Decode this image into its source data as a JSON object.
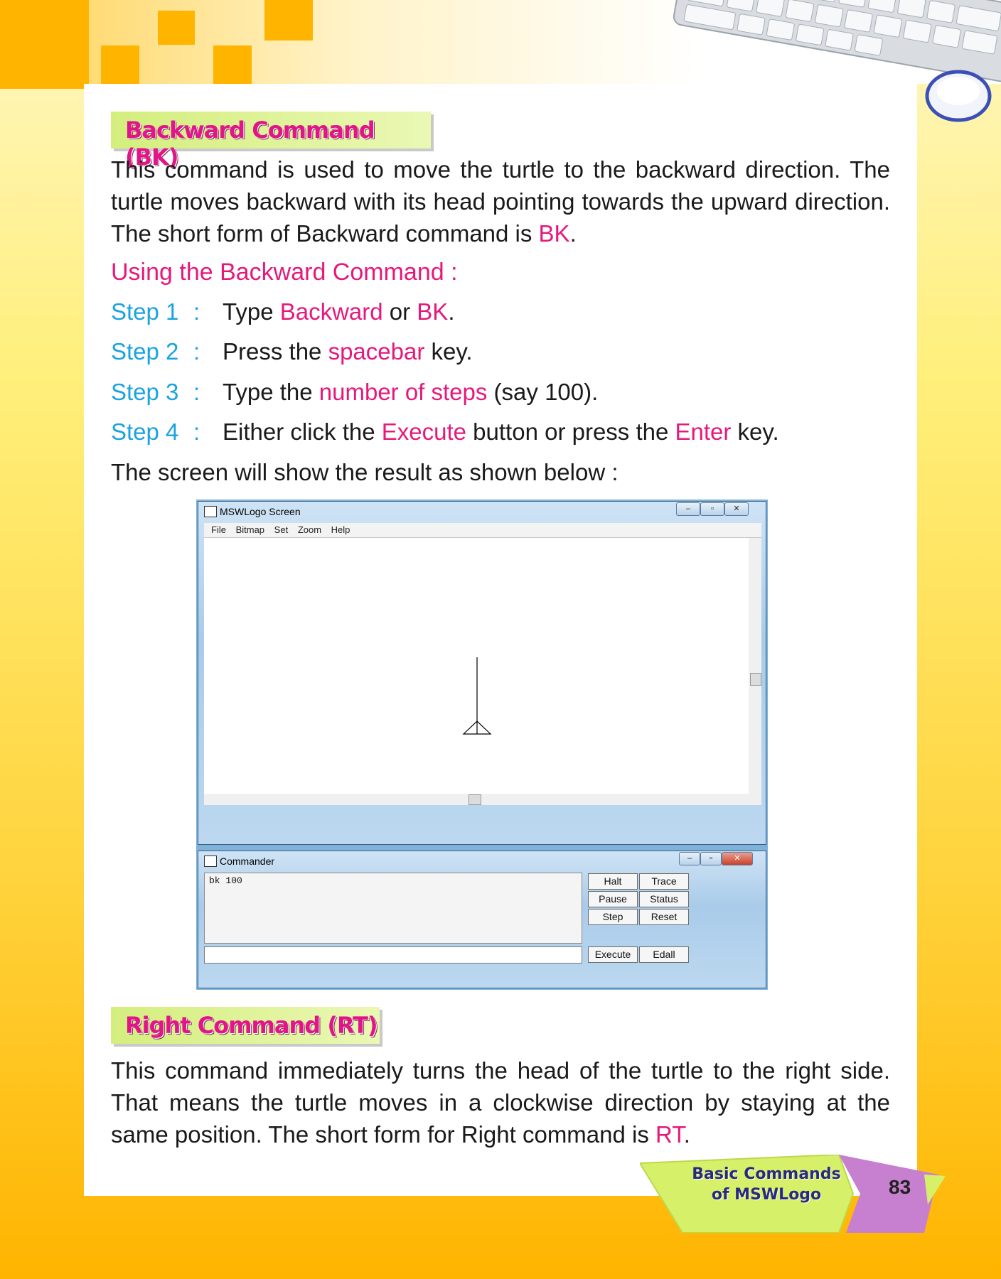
{
  "section1": {
    "heading": "Backward Command (BK)",
    "para_a": "This command is used to move the turtle to the backward direction. The turtle moves backward with its head pointing towards the upward direction. The short form of Backward command is ",
    "para_abbr": "BK",
    "para_end": ".",
    "subheading": "Using the Backward Command :",
    "steps": [
      {
        "label": "Step 1",
        "colon": ":",
        "t1": "Type ",
        "h1": "Backward",
        "t2": " or ",
        "h2": "BK",
        "t3": "."
      },
      {
        "label": "Step 2",
        "colon": ":",
        "t1": "Press the ",
        "h1": "spacebar",
        "t2": " key."
      },
      {
        "label": "Step 3",
        "colon": ":",
        "t1": "Type the ",
        "h1": "number of steps",
        "t2": " (say 100)."
      },
      {
        "label": "Step 4",
        "colon": ":",
        "t1": "Either click the ",
        "h1": "Execute",
        "t2": " button or press the ",
        "h2": "Enter",
        "t3": " key."
      }
    ],
    "result_line": "The screen will show the result as shown below :"
  },
  "screenshot": {
    "screen_title": "MSWLogo Screen",
    "menu": [
      "File",
      "Bitmap",
      "Set",
      "Zoom",
      "Help"
    ],
    "window_buttons": {
      "minimize": "–",
      "maximize": "▫",
      "close": "✕"
    },
    "commander_title": "Commander",
    "command_text": "bk 100",
    "buttons": {
      "halt": "Halt",
      "trace": "Trace",
      "pause": "Pause",
      "status": "Status",
      "step": "Step",
      "reset": "Reset",
      "execute": "Execute",
      "edall": "Edall"
    }
  },
  "section2": {
    "heading": "Right Command (RT)",
    "para_a": "This command immediately turns the head of the turtle to the right side. That means the turtle moves in a clockwise direction by staying at the same position. The short form for Right command is ",
    "para_abbr": "RT",
    "para_end": "."
  },
  "footer": {
    "tab_line1": "Basic Commands",
    "tab_line2": "of MSWLogo",
    "page_number": "83"
  },
  "colors": {
    "accent_pink": "#e6187c",
    "accent_cyan": "#1aa3e0",
    "heading_green": "#d4ee7e"
  }
}
